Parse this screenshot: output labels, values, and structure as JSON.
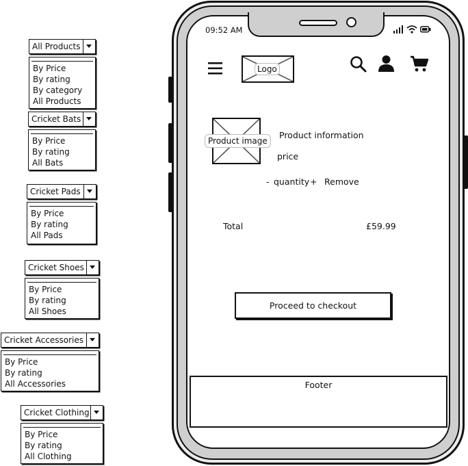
{
  "dropdowns": [
    {
      "label": "All Products",
      "options": [
        "By Price",
        "By rating",
        "By category",
        "All Products"
      ]
    },
    {
      "label": "Cricket Bats",
      "options": [
        "By Price",
        "By rating",
        "All Bats"
      ]
    },
    {
      "label": "Cricket Pads",
      "options": [
        "By Price",
        "By rating",
        "All Pads"
      ]
    },
    {
      "label": "Cricket Shoes",
      "options": [
        "By Price",
        "By rating",
        "All Shoes"
      ]
    },
    {
      "label": "Cricket Accessories",
      "options": [
        "By Price",
        "By rating",
        "All Accessories"
      ]
    },
    {
      "label": "Cricket Clothing",
      "options": [
        "By Price",
        "By rating",
        "All Clothing"
      ]
    }
  ],
  "status_bar": {
    "time": "09:52 AM"
  },
  "header": {
    "logo_label": "Logo"
  },
  "icons": {
    "menu": "hamburger-menu-icon",
    "search": "search-icon",
    "account": "user-icon",
    "cart": "cart-icon",
    "signal": "signal-icon",
    "wifi": "wifi-icon",
    "battery": "battery-icon"
  },
  "cart_item": {
    "image_label": "Product image",
    "info": "Product information",
    "price": "price",
    "decrement": "-",
    "quantity": "quantity",
    "increment": "+",
    "remove": "Remove"
  },
  "summary": {
    "total_label": "Total",
    "total_value": "£59.99"
  },
  "checkout_label": "Proceed to checkout",
  "footer_label": "Footer"
}
